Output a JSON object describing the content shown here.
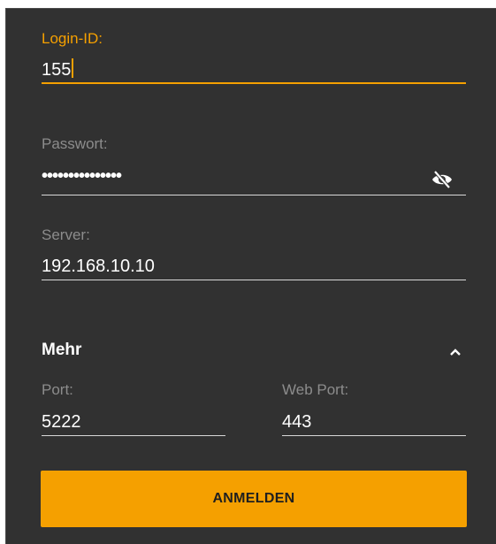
{
  "login_id": {
    "label": "Login-ID:",
    "value": "155"
  },
  "password": {
    "label": "Passwort:",
    "value": "•••••••••••••••",
    "toggle_icon": "eye-off-icon"
  },
  "server": {
    "label": "Server:",
    "value": "192.168.10.10"
  },
  "more_section": {
    "title": "Mehr",
    "toggle_icon": "chevron-up-icon"
  },
  "port": {
    "label": "Port:",
    "value": "5222"
  },
  "web_port": {
    "label": "Web Port:",
    "value": "443"
  },
  "login_button": {
    "label": "ANMELDEN"
  },
  "colors": {
    "background": "#313131",
    "accent": "#f5a000",
    "label": "#8c8c8c",
    "text": "#ffffff"
  }
}
